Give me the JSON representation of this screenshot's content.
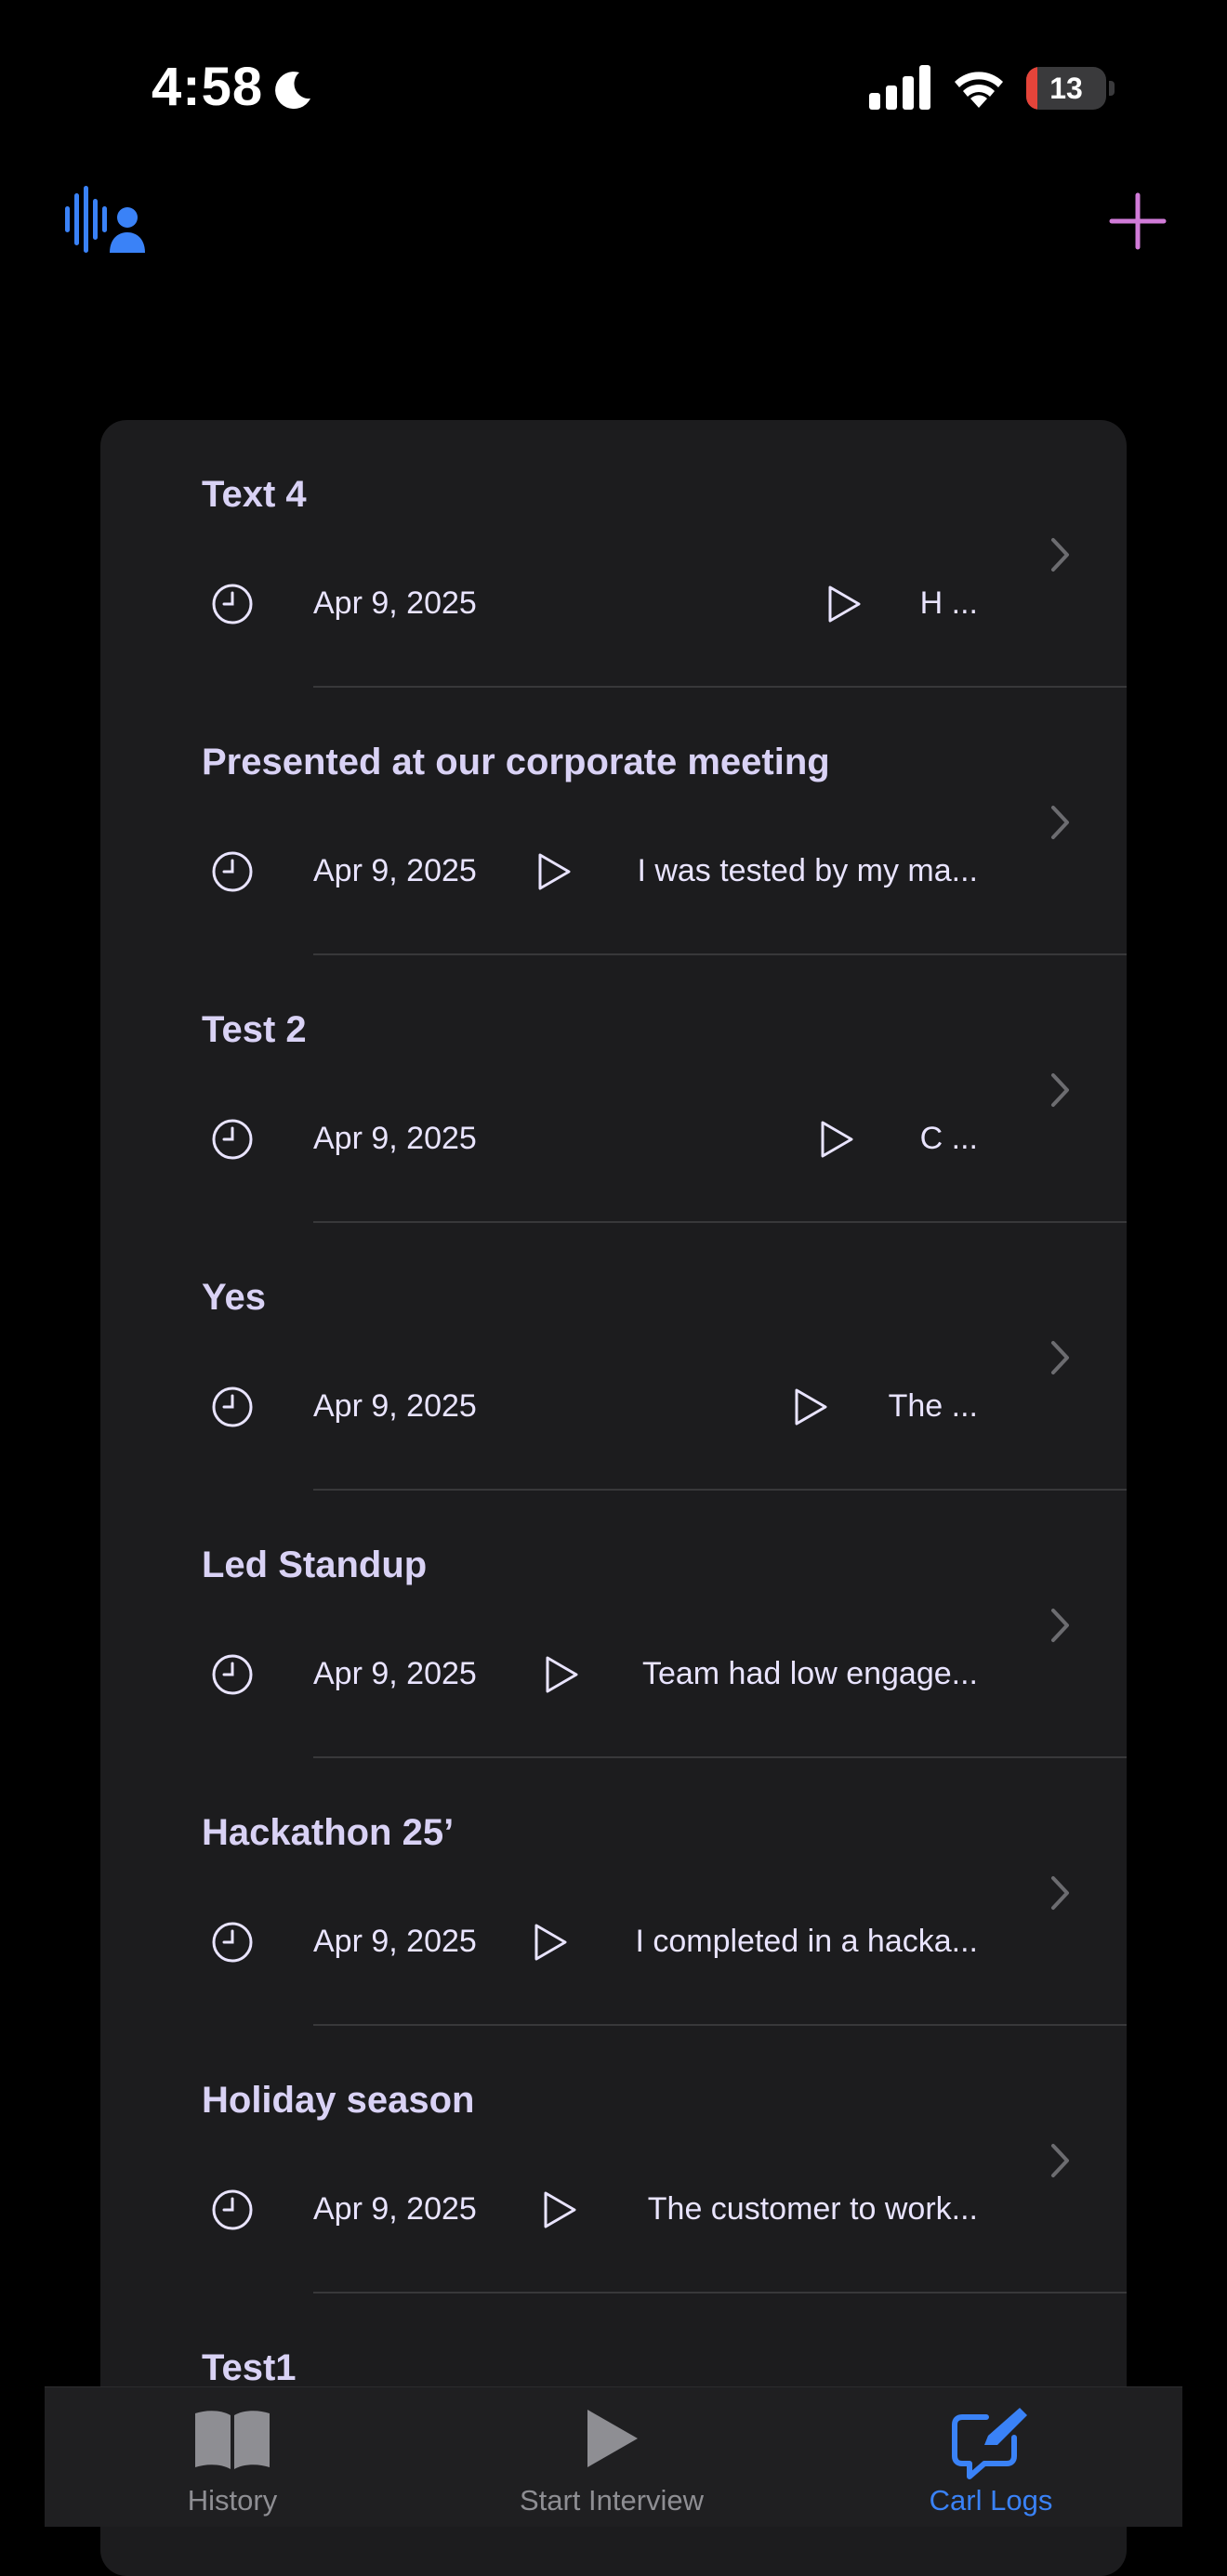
{
  "status_bar": {
    "time": "4:58",
    "battery_level": "13"
  },
  "header": {
    "logo_icon": "voice-profile-icon",
    "add_icon": "plus-icon"
  },
  "colors": {
    "background": "#000000",
    "card": "#1c1c1e",
    "title": "#d9d2f5",
    "accent_blue": "#3a82f7",
    "accent_pink": "#d17bd8",
    "tab_inactive": "#8e8e93"
  },
  "logs": [
    {
      "title": "Text 4",
      "date": "Apr 9, 2025",
      "preview": "H ..."
    },
    {
      "title": "Presented at our corporate meeting",
      "date": "Apr 9, 2025",
      "preview": "I was tested by my ma..."
    },
    {
      "title": "Test 2",
      "date": "Apr 9, 2025",
      "preview": "C  ..."
    },
    {
      "title": "Yes",
      "date": "Apr 9, 2025",
      "preview": "The ..."
    },
    {
      "title": "Led Standup",
      "date": "Apr 9, 2025",
      "preview": "Team had low engage..."
    },
    {
      "title": "Hackathon 25’",
      "date": "Apr 9, 2025",
      "preview": "I completed in a hacka..."
    },
    {
      "title": "Holiday season",
      "date": "Apr 9, 2025",
      "preview": "The customer to work..."
    },
    {
      "title": "Test1",
      "date": "",
      "preview": ""
    }
  ],
  "tabs": [
    {
      "label": "History",
      "icon": "book-icon",
      "selected": false
    },
    {
      "label": "Start Interview",
      "icon": "play-icon",
      "selected": false
    },
    {
      "label": "Carl Logs",
      "icon": "compose-icon",
      "selected": true
    }
  ]
}
